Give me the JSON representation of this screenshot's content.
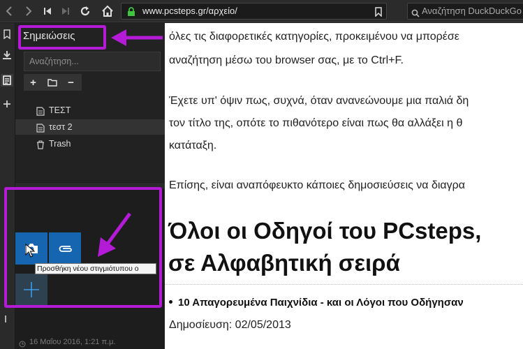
{
  "browser": {
    "url": "www.pcsteps.gr/αρχείο/",
    "search_placeholder": "Αναζήτηση DuckDuckGo"
  },
  "notes_panel": {
    "title": "Σημειώσεις",
    "search_placeholder": "Αναζήτηση...",
    "toolbar_buttons": [
      "+",
      "folder",
      "−"
    ],
    "items": [
      {
        "label": "ΤΕΣΤ",
        "icon": "note-icon"
      },
      {
        "label": "τεστ 2",
        "icon": "note-icon"
      },
      {
        "label": "Trash",
        "icon": "trash-icon"
      }
    ],
    "tooltip": "Προσθήκη νέου στιγμιότυπου ο",
    "date": "16 Μαΐου 2016, 1:21 π.μ."
  },
  "article": {
    "paragraphs": [
      [
        "όλες τις διαφορετικές κατηγορίες, προκειμένου να μπορέσε",
        "αναζήτηση μέσω του browser σας, με το Ctrl+F."
      ],
      [
        "Έχετε υπ' όψιν πως, συχνά, όταν ανανεώνουμε μια παλιά δη",
        "τον τίτλο της, οπότε το πιθανότερο είναι πως θα αλλάξει η θ",
        "κατάταξη."
      ],
      [
        "Επίσης, είναι αναπόφευκτο κάποιες δημοσιεύσεις να διαγρα"
      ]
    ],
    "heading_lines": [
      "Όλοι οι Οδηγοί του PCsteps,",
      "σε Αλφαβητική σειρά"
    ],
    "bullet_item": "10 Απαγορευμένα Παιχνίδια - και οι Λόγοι που Οδήγησαν",
    "published": "Δημοσίευση: 02/05/2013"
  },
  "colors": {
    "highlight": "#b31bd6",
    "tile_blue": "#1565b0",
    "tile_add": "#2d4150"
  }
}
